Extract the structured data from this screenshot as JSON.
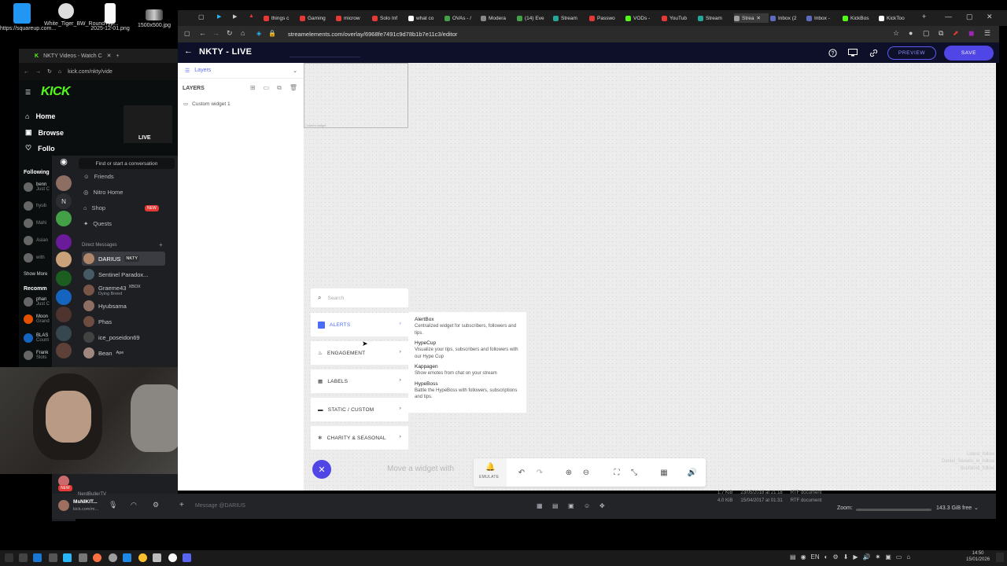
{
  "desktop": {
    "icons": [
      {
        "label": "https://squareup.com..."
      },
      {
        "label": "White_Tiger_BW_RoundTyp..."
      },
      {
        "label": "2025-12-01.png"
      },
      {
        "label": "1500x500.jpg"
      }
    ]
  },
  "kick": {
    "tab_title": "NKTY Videos - Watch C",
    "url": "kick.com/nkty/vide",
    "logo": "KICK",
    "nav": [
      "Home",
      "Browse",
      "Follo"
    ],
    "following_title": "Following",
    "following": [
      {
        "name": "benn",
        "sub": "Just C"
      },
      {
        "name": "hyub",
        "sub": ""
      },
      {
        "name": "Mahi",
        "sub": ""
      },
      {
        "name": "Asian",
        "sub": ""
      },
      {
        "name": "with",
        "sub": ""
      }
    ],
    "show_more": "Show More",
    "recommended_title": "Recomm",
    "recommended": [
      {
        "name": "phan",
        "sub": "Just C"
      },
      {
        "name": "Moon",
        "sub": "Grand"
      },
      {
        "name": "BLAS",
        "sub": "Count"
      },
      {
        "name": "Frank",
        "sub": "Slots"
      }
    ],
    "live_badge": "LIVE"
  },
  "discord": {
    "search_placeholder": "Find or start a conversation",
    "menu": [
      "Friends",
      "Nitro Home",
      "Shop",
      "Quests"
    ],
    "shop_badge": "NEW",
    "dm_header": "Direct Messages",
    "dms": [
      {
        "name": "DARIUS",
        "tag": "NKTY",
        "sub": ""
      },
      {
        "name": "Sentinel Paradox...",
        "tag": "",
        "sub": ""
      },
      {
        "name": "Graeme43",
        "tag": "XBOX",
        "sub": "Dying Breed"
      },
      {
        "name": "Hyubsama",
        "tag": "",
        "sub": ""
      },
      {
        "name": "Phas",
        "tag": "",
        "sub": ""
      },
      {
        "name": "ice_poseidon69",
        "tag": "",
        "sub": ""
      },
      {
        "name": "Bean",
        "tag": "Ape",
        "sub": ""
      }
    ],
    "rail_letter": "N",
    "user_name": "MsNIKIT...",
    "user_sub": "kick.com/m...",
    "next_user": "NerdBullerTV",
    "new_badge": "NEW",
    "message_placeholder": "Message @DARIUS"
  },
  "browser": {
    "tabs": [
      "things c",
      "Gaming",
      "microw",
      "Solo Inf",
      "what co",
      "OVAs - /",
      "Modera",
      "(14) Eve",
      "Stream",
      "Passwo",
      "VODs -",
      "YouTub",
      "Stream",
      "Strea",
      "Inbox (2",
      "Inbox -",
      "KickBos",
      "KickToo"
    ],
    "tab_colors": [
      "#e53935",
      "#e53935",
      "#e53935",
      "#e53935",
      "#ffffff",
      "#43a047",
      "#888888",
      "#43a047",
      "#26a69a",
      "#e53935",
      "#53fc18",
      "#e53935",
      "#26a69a",
      "#9e9e9e",
      "#5c6bc0",
      "#5c6bc0",
      "#53fc18",
      "#ffffff"
    ],
    "url": "streamelements.com/overlay/6968fe7491c9d78b1b7e11c3/editor"
  },
  "editor": {
    "title": "NKTY - LIVE",
    "preview_label": "PREVIEW",
    "save_label": "SAVE",
    "layers_tab": "Layers",
    "layers_heading": "LAYERS",
    "layers": [
      "Custom widget 1"
    ],
    "widget_caption": "Custom widget",
    "search_placeholder": "Search",
    "categories": [
      {
        "label": "ALERTS",
        "icon": "alerts-icon",
        "active": true
      },
      {
        "label": "ENGAGEMENT",
        "icon": "fire-icon",
        "active": false
      },
      {
        "label": "LABELS",
        "icon": "grid-icon",
        "active": false
      },
      {
        "label": "STATIC / CUSTOM",
        "icon": "code-icon",
        "active": false
      },
      {
        "label": "CHARITY & SEASONAL",
        "icon": "snowflake-icon",
        "active": false
      }
    ],
    "submenu": [
      {
        "title": "AlertBox",
        "desc": "Centralized widget for subscribers, followers and tips."
      },
      {
        "title": "HypeCup",
        "desc": "Visualize your tips, subscribers and followers with our Hype Cup"
      },
      {
        "title": "Kappagen",
        "desc": "Show emotes from chat on your stream"
      },
      {
        "title": "HypeBoss",
        "desc": "Battle the HypeBoss with followers, subscriptions and tips."
      }
    ],
    "hint": "Move a widget with",
    "emulate_label": "EMULATE",
    "canvas_overlay_text": [
      "Latest_follow",
      "Daniel_Sweeto_in_follow",
      "buufaloid_follow"
    ]
  },
  "files": {
    "rows": [
      {
        "size": "1.7 KiB",
        "date": "23/05/2018 at 21:18",
        "type": "RTF document"
      },
      {
        "size": "4.0 KiB",
        "date": "15/04/2017 at 01:31",
        "type": "RTF document"
      }
    ],
    "zoom_label": "Zoom:",
    "free_space": "143.3 GiB free"
  },
  "taskbar": {
    "time": "14:50",
    "date": "15/01/2026",
    "lang": "EN"
  }
}
